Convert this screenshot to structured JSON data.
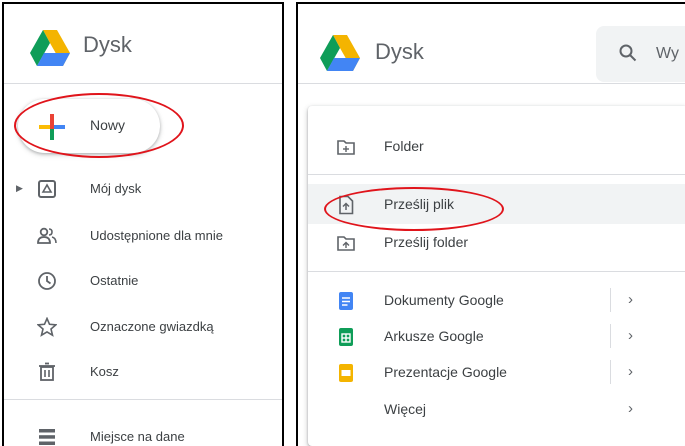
{
  "left_panel": {
    "app_title": "Dysk",
    "new_button": {
      "label": "Nowy",
      "icon": "plus-icon"
    },
    "nav": [
      {
        "label": "Mój dysk",
        "icon": "drive-folder-icon",
        "expandable": true
      },
      {
        "label": "Udostępnione dla mnie",
        "icon": "people-icon"
      },
      {
        "label": "Ostatnie",
        "icon": "clock-icon"
      },
      {
        "label": "Oznaczone gwiazdką",
        "icon": "star-icon"
      },
      {
        "label": "Kosz",
        "icon": "trash-icon"
      },
      {
        "label": "Miejsce na dane",
        "icon": "storage-icon"
      }
    ]
  },
  "right_panel": {
    "app_title": "Dysk",
    "search_placeholder": "Wy",
    "menu": [
      {
        "label": "Folder",
        "icon": "new-folder-icon"
      },
      {
        "label": "Prześlij plik",
        "icon": "file-upload-icon",
        "highlighted": true
      },
      {
        "label": "Prześlij folder",
        "icon": "folder-upload-icon"
      },
      {
        "label": "Dokumenty Google",
        "icon": "google-docs-icon",
        "submenu": true
      },
      {
        "label": "Arkusze Google",
        "icon": "google-sheets-icon",
        "submenu": true
      },
      {
        "label": "Prezentacje Google",
        "icon": "google-slides-icon",
        "submenu": true
      },
      {
        "label": "Więcej",
        "submenu": true
      }
    ]
  },
  "colors": {
    "drive_green": "#0f9d58",
    "drive_yellow": "#f4b400",
    "drive_blue": "#4285f4",
    "annotation_red": "#e0141b",
    "docs_blue": "#4285f4",
    "sheets_green": "#0f9d58",
    "slides_yellow": "#f4b400"
  }
}
